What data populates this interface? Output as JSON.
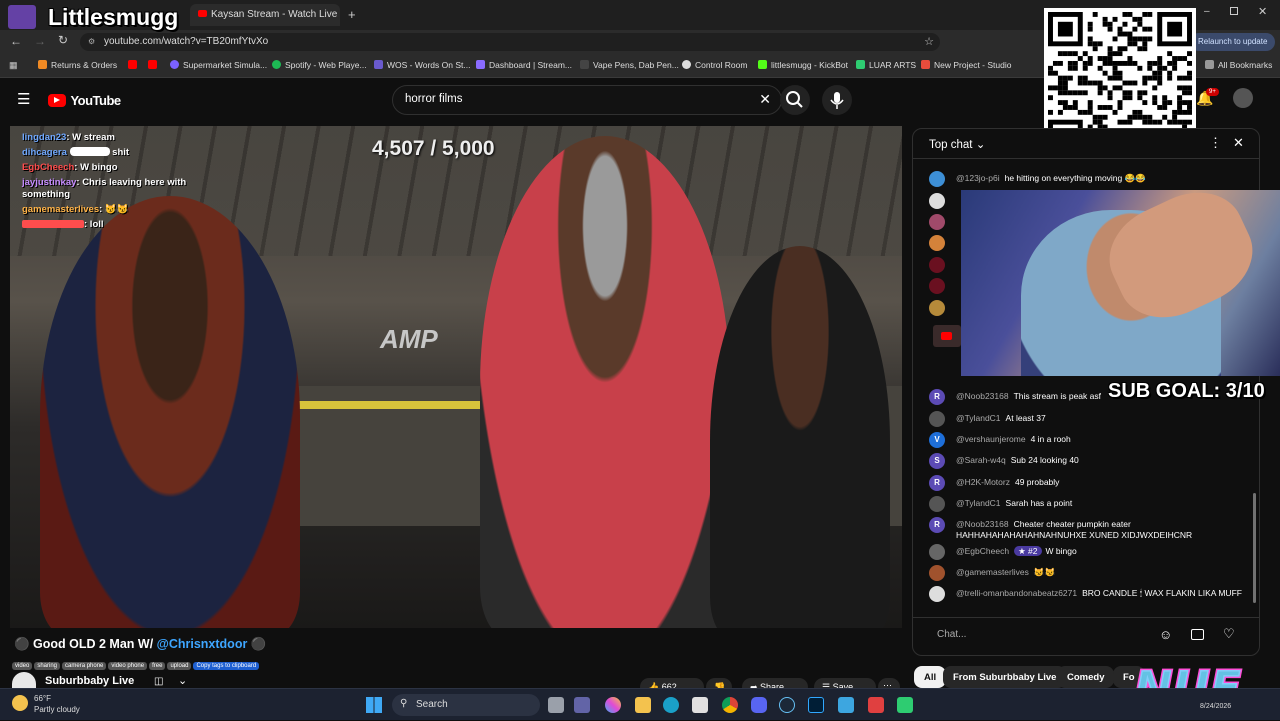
{
  "overlay": {
    "streamer_name": "Littlesmugg",
    "counter": "4,507 / 5,000",
    "sub_goal": "SUB GOAL: 3/10",
    "chat_lines": [
      {
        "user": "lingdan23",
        "text": ": W stream",
        "color": "#6fa8ff"
      },
      {
        "user": "dihcagera",
        "text": "shit",
        "color": "#6fa8ff"
      },
      {
        "user": "EgbCheech",
        "text": ": W bingo",
        "color": "#ff4d4d"
      },
      {
        "user": "jayjustinkay",
        "text": ": Chris leaving here with something",
        "color": "#c58bff"
      },
      {
        "user": "gamemasterlives",
        "text": ": 😼😼",
        "color": "#ffb347"
      },
      {
        "user": "",
        "text": ": loll",
        "color": "#ff4d4d"
      }
    ]
  },
  "browser": {
    "active_tab": "Kaysan Stream - Watch Live on",
    "url": "youtube.com/watch?v=TB20mfYtvXo",
    "relaunch": "Relaunch to update",
    "bookmarks": [
      {
        "label": "Returns & Orders",
        "color": "#f08a24"
      },
      {
        "label": "Supermarket Simula...",
        "color": "#7b61ff"
      },
      {
        "label": "Spotify - Web Playe...",
        "color": "#1db954"
      },
      {
        "label": "WOS - Words On St...",
        "color": "#6a5acd"
      },
      {
        "label": "Dashboard | Stream...",
        "color": "#8a6bff"
      },
      {
        "label": "Vape Pens, Dab Pen...",
        "color": "#444444"
      },
      {
        "label": "Control Room",
        "color": "#dddddd"
      },
      {
        "label": "littlesmugg - KickBot",
        "color": "#53fc18"
      },
      {
        "label": "LUAR ARTS",
        "color": "#2ecc71"
      },
      {
        "label": "New Project - Studio",
        "color": "#e74c3c"
      },
      {
        "label": "All Bookmarks",
        "color": "#999999"
      }
    ]
  },
  "youtube": {
    "brand": "YouTube",
    "search_query": "horror films",
    "notif_count": "9+"
  },
  "video": {
    "title_pre": "Good OLD 2 Man W/ ",
    "title_mention": "@Chrisnxtdoor",
    "tags": [
      "video",
      "sharing",
      "camera phone",
      "video phone",
      "free",
      "upload"
    ],
    "copy_tags": "Copy tags to clipboard",
    "channel": "Suburbbaby Live",
    "likes": "662",
    "share": "Share",
    "save": "Save",
    "wall_sign": "AMP"
  },
  "chat": {
    "header": "Top chat",
    "input_placeholder": "Chat...",
    "messages": [
      {
        "author": "@123jo-p6i",
        "text": "he hitting on everything moving 😂😂",
        "avatar_color": "#3d8fd6",
        "avatar_letter": ""
      },
      {
        "author": "@Noob23168",
        "text": "This stream is peak asf",
        "avatar_color": "#5c4bb5",
        "avatar_letter": "R"
      },
      {
        "author": "@TylandC1",
        "text": "At least 37",
        "avatar_color": "#555555",
        "avatar_letter": ""
      },
      {
        "author": "@vershaunjerome",
        "text": "4 in a rooh",
        "avatar_color": "#1e6fd9",
        "avatar_letter": "V"
      },
      {
        "author": "@Sarah-w4q",
        "text": "Sub 24 looking 40",
        "avatar_color": "#5c4bb5",
        "avatar_letter": "S"
      },
      {
        "author": "@H2K-Motorz",
        "text": "49 probably",
        "avatar_color": "#5c4bb5",
        "avatar_letter": "R"
      },
      {
        "author": "@TylandC1",
        "text": "Sarah has a point",
        "avatar_color": "#555555",
        "avatar_letter": ""
      },
      {
        "author": "@Noob23168",
        "text": "Cheater cheater pumpkin eater HAHHAHAHAHAHAHNAHNUHXE XUNED XIDJWXDEIHCNR",
        "avatar_color": "#5c4bb5",
        "avatar_letter": "R"
      },
      {
        "author": "@EgbCheech",
        "text": "W bingo",
        "avatar_color": "#666666",
        "avatar_letter": "",
        "badge": "#2"
      },
      {
        "author": "@gamemasterlives",
        "text": "😼😼",
        "avatar_color": "#a0522d",
        "avatar_letter": ""
      },
      {
        "author": "@trelli-omanbandonabeatz6271",
        "text": "BRO CANDLE 🕯 WAX FLAKIN LIKA MUFF",
        "avatar_color": "#dddddd",
        "avatar_letter": ""
      }
    ]
  },
  "chips": [
    {
      "label": "All",
      "active": true
    },
    {
      "label": "From Suburbbaby Live",
      "active": false
    },
    {
      "label": "Comedy",
      "active": false
    },
    {
      "label": "Fo",
      "active": false
    }
  ],
  "taskbar": {
    "temp": "66°F",
    "weather": "Partly cloudy",
    "search": "Search",
    "date": "8/24/2026"
  }
}
